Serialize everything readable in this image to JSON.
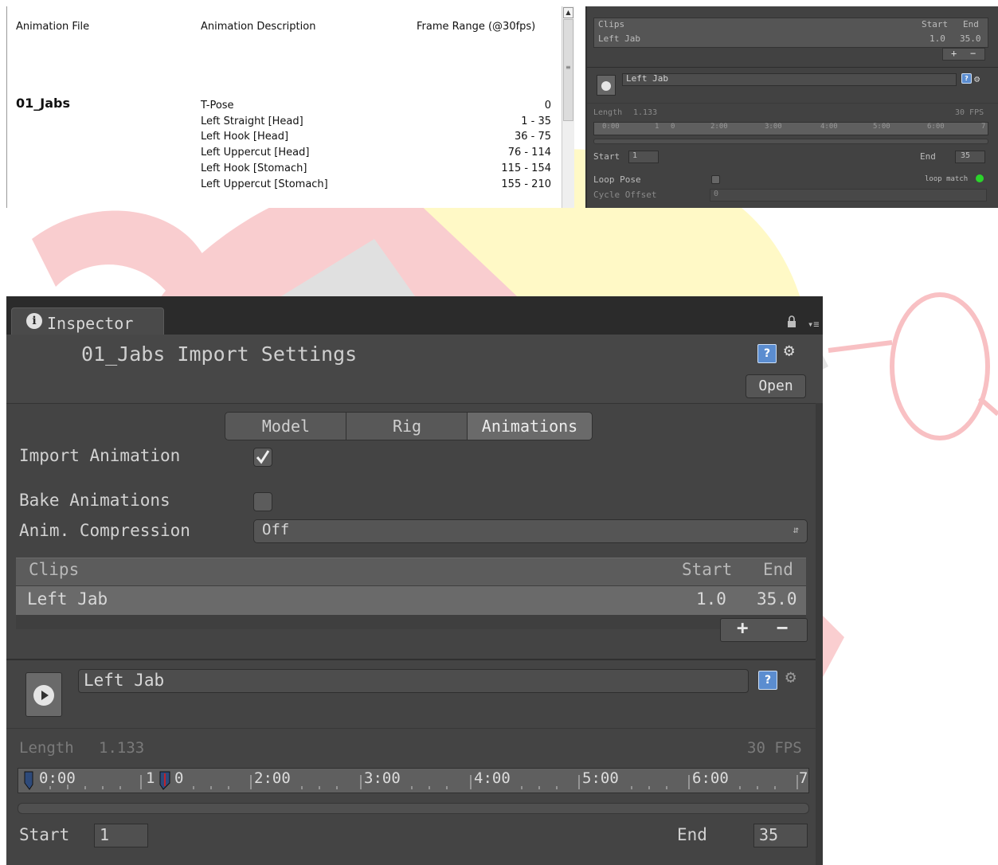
{
  "doc": {
    "headers": [
      "Animation File",
      "Animation Description",
      "Frame Range (@30fps)"
    ],
    "file_title": "01_Jabs",
    "rows": [
      {
        "description": "T-Pose",
        "range": "0"
      },
      {
        "description": "Left Straight [Head]",
        "range": "1 - 35"
      },
      {
        "description": "Left Hook [Head]",
        "range": "36 - 75"
      },
      {
        "description": "Left Uppercut [Head]",
        "range": "76 - 114"
      },
      {
        "description": "Left Hook [Stomach]",
        "range": "115 - 154"
      },
      {
        "description": "Left Uppercut [Stomach]",
        "range": "155 - 210"
      }
    ]
  },
  "mini": {
    "clips_label": "Clips",
    "start_label": "Start",
    "end_label": "End",
    "clip_name": "Left Jab",
    "clip_start": "1.0",
    "clip_end": "35.0",
    "plus": "+",
    "minus": "−",
    "name_value": "Left Jab",
    "length_label": "Length",
    "length_value": "1.133",
    "fps": "30 FPS",
    "ticks": [
      "0:00",
      "1",
      "0",
      "2:00",
      "3:00",
      "4:00",
      "5:00",
      "6:00",
      "7"
    ],
    "start_value": "1",
    "end_value": "35",
    "loop_pose_label": "Loop Pose",
    "loop_match_label": "loop match",
    "cycle_offset_label": "Cycle Offset",
    "cycle_offset_value": "0"
  },
  "inspector": {
    "tab_label": "Inspector",
    "info_icon": "i",
    "title": "01_Jabs Import Settings",
    "open_button": "Open",
    "tabs": [
      "Model",
      "Rig",
      "Animations"
    ],
    "active_tab": "Animations",
    "import_animation_label": "Import Animation",
    "import_animation_checked": true,
    "bake_animations_label": "Bake Animations",
    "bake_animations_checked": false,
    "compression_label": "Anim. Compression",
    "compression_value": "Off",
    "clips_header": "Clips",
    "clips_start_header": "Start",
    "clips_end_header": "End",
    "clips": [
      {
        "name": "Left Jab",
        "start": "1.0",
        "end": "35.0"
      }
    ],
    "plus": "+",
    "minus": "−",
    "clip_name_value": "Left Jab",
    "length_label": "Length",
    "length_value": "1.133",
    "fps_label": "30 FPS",
    "timeline_ticks": [
      "0:00",
      "1",
      "0",
      "2:00",
      "3:00",
      "4:00",
      "5:00",
      "6:00",
      "7"
    ],
    "start_label": "Start",
    "start_value": "1",
    "end_label": "End",
    "end_value": "35",
    "help_icon": "?",
    "gear_icon": "⚙"
  },
  "colors": {
    "panel": "#444444",
    "tabbar": "#2b2b2b",
    "background_logo_red": "#e8222a",
    "background_logo_yellow": "#ffe600"
  }
}
